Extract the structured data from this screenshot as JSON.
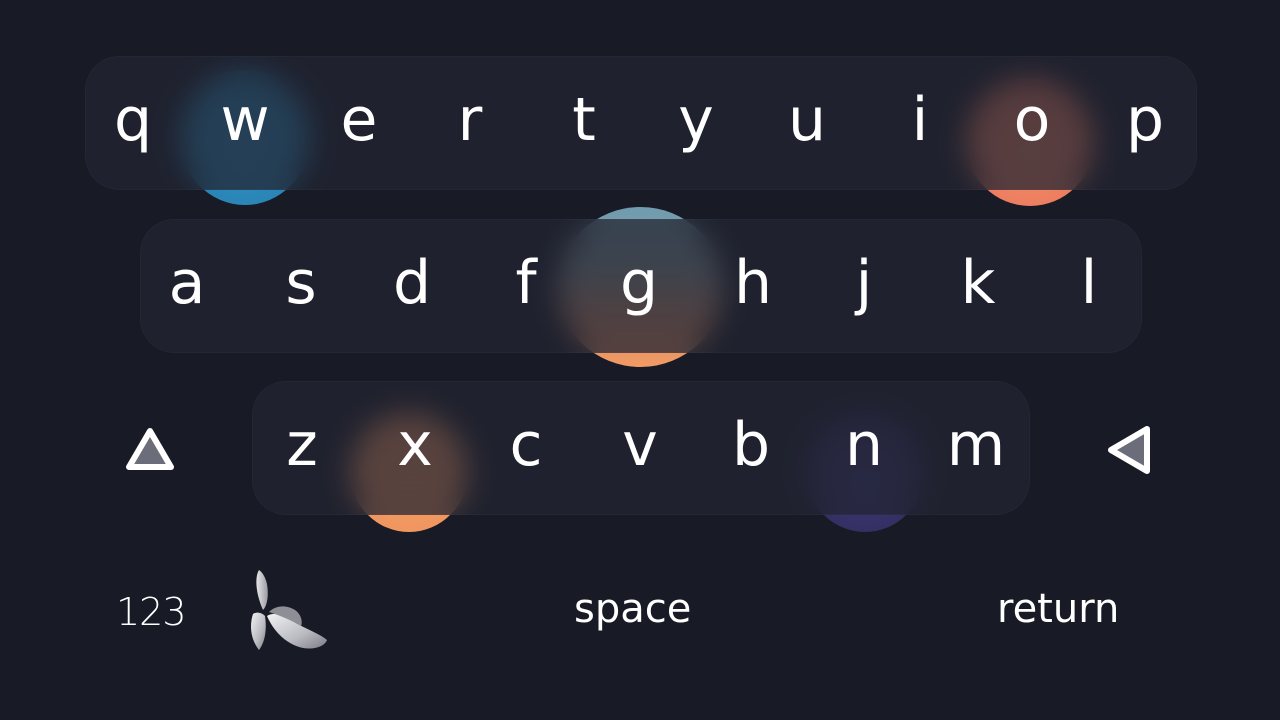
{
  "keyboard": {
    "rows": [
      {
        "keys": [
          "q",
          "w",
          "e",
          "r",
          "t",
          "y",
          "u",
          "i",
          "o",
          "p"
        ]
      },
      {
        "keys": [
          "a",
          "s",
          "d",
          "f",
          "g",
          "h",
          "j",
          "k",
          "l"
        ]
      },
      {
        "keys": [
          "z",
          "x",
          "c",
          "v",
          "b",
          "n",
          "m"
        ]
      }
    ],
    "bottom": {
      "numbers_label": "123",
      "space_label": "space",
      "return_label": "return"
    },
    "icons": {
      "shift": "shift-icon",
      "backspace": "backspace-icon",
      "banana": "banana-icon"
    },
    "blob_colors": {
      "teal_blue": "#2a86b6",
      "coral": "#f08563",
      "peach": "#ef9a63",
      "indigo": "#3a3468",
      "steel_blue": "#6f9cb0"
    }
  }
}
